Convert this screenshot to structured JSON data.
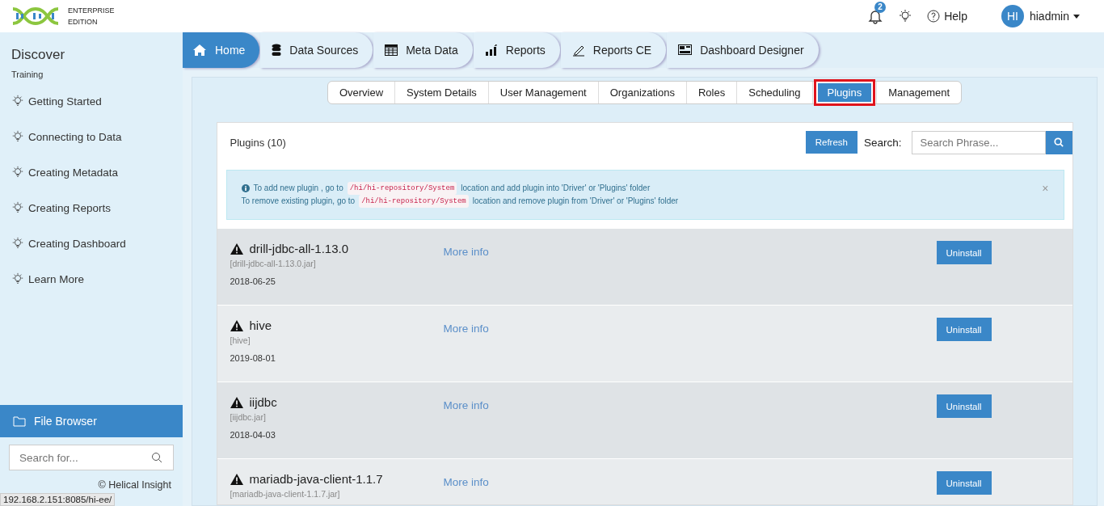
{
  "header": {
    "edition": [
      "ENTERPRISE",
      "EDITION"
    ],
    "notifications": "2",
    "help": "Help",
    "avatar": "HI",
    "user": "hiadmin"
  },
  "sidebar": {
    "title": "Discover",
    "subtitle": "Training",
    "items": [
      "Getting Started",
      "Connecting to Data",
      "Creating Metadata",
      "Creating Reports",
      "Creating Dashboard",
      "Learn More"
    ],
    "file_browser": "File Browser",
    "search": {
      "placeholder": "Search for..."
    },
    "footer": [
      "© Helical Insight"
    ],
    "status_url": "192.168.2.151:8085/hi-ee/"
  },
  "nav_tabs": [
    {
      "label": "Home",
      "selected": true
    },
    {
      "label": "Data Sources",
      "selected": false
    },
    {
      "label": "Meta Data",
      "selected": false
    },
    {
      "label": "Reports",
      "selected": false
    },
    {
      "label": "Reports CE",
      "selected": false
    },
    {
      "label": "Dashboard Designer",
      "selected": false
    }
  ],
  "sub_tabs": [
    {
      "label": "Overview",
      "selected": false
    },
    {
      "label": "System Details",
      "selected": false
    },
    {
      "label": "User Management",
      "selected": false
    },
    {
      "label": "Organizations",
      "selected": false
    },
    {
      "label": "Roles",
      "selected": false
    },
    {
      "label": "Scheduling",
      "selected": false
    },
    {
      "label": "Plugins",
      "selected": true,
      "highlighted": true
    },
    {
      "label": "Management",
      "selected": false
    }
  ],
  "panel": {
    "title": "Plugins (10)",
    "refresh": "Refresh",
    "search_label": "Search:",
    "search": {
      "placeholder": "Search Phrase..."
    }
  },
  "alert": {
    "lines": [
      {
        "before": "To add new plugin , go to",
        "code": "/hi/hi-repository/System",
        "after": "location and add plugin into 'Driver' or 'Plugins' folder"
      },
      {
        "before": "To remove existing plugin, go to",
        "code": "/hi/hi-repository/System",
        "after": "location and remove plugin from 'Driver' or 'Plugins' folder"
      }
    ],
    "close": "×"
  },
  "plugins": [
    {
      "name": "drill-jdbc-all-1.13.0",
      "file": "[drill-jdbc-all-1.13.0.jar]",
      "date": "2018-06-25",
      "link": "More info",
      "action": "Uninstall"
    },
    {
      "name": "hive",
      "file": "[hive]",
      "date": "2019-08-01",
      "link": "More info",
      "action": "Uninstall"
    },
    {
      "name": "iijdbc",
      "file": "[iijdbc.jar]",
      "date": "2018-04-03",
      "link": "More info",
      "action": "Uninstall"
    },
    {
      "name": "mariadb-java-client-1.1.7",
      "file": "[mariadb-java-client-1.1.7.jar]",
      "link": "More info",
      "action": "Uninstall"
    }
  ]
}
